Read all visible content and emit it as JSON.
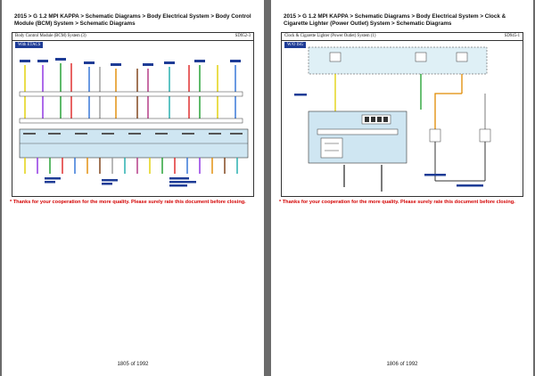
{
  "pages": [
    {
      "breadcrumb": "2015 > G 1.2 MPI KAPPA > Schematic Diagrams > Body Electrical System > Body Control Module (BCM) System > Schematic Diagrams",
      "diagram_title": "Body Control Module (BCM) System (3)",
      "diagram_code": "SD952-3",
      "variant_tag": "With ETACS",
      "notice": "* Thanks for your cooperation for the more quality. Please surely rate this document before closing.",
      "page_number": "1805 of 1992"
    },
    {
      "breadcrumb": "2015 > G 1.2 MPI KAPPA > Schematic Diagrams > Body Electrical System > Clock & Cigarette Lighter (Power Outlet) System > Schematic Diagrams",
      "diagram_title": "Clock & Cigarette Lighter (Power Outlet) System (1)",
      "diagram_code": "SD945-1",
      "variant_tag": "W/O ISG",
      "notice": "* Thanks for your cooperation for the more quality. Please surely rate this document before closing.",
      "page_number": "1806 of 1992"
    }
  ],
  "colors": {
    "background": "#6b6b6b",
    "notice": "#d40000",
    "variant_tag": "#1e3c96",
    "wires": [
      "#e0d000",
      "#8a2be2",
      "#1a9d2a",
      "#d22",
      "#2a6fd6",
      "#e08a00",
      "#7a3c10",
      "#999999",
      "#1aaaaa",
      "#b0307f"
    ],
    "module_fill": "#cfe6f2"
  }
}
